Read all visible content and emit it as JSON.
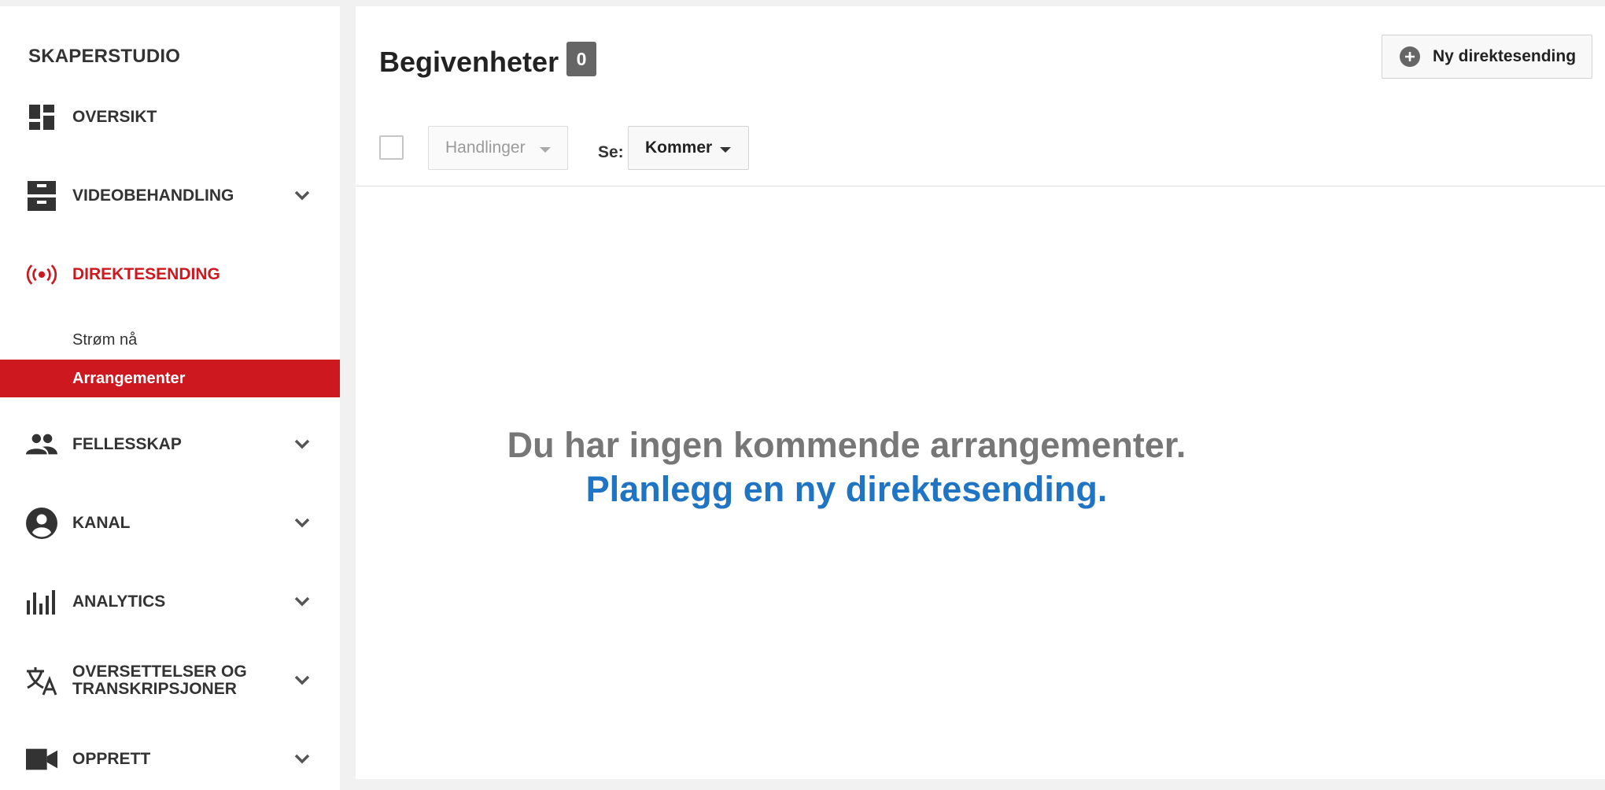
{
  "sidebar": {
    "brand": "SKAPERSTUDIO",
    "items": [
      {
        "label": "OVERSIKT",
        "icon": "dashboard-icon"
      },
      {
        "label": "VIDEOBEHANDLING",
        "icon": "video-manager-icon"
      },
      {
        "label": "DIREKTESENDING",
        "icon": "live-broadcast-icon",
        "active": true
      },
      {
        "label": "FELLESSKAP",
        "icon": "community-icon"
      },
      {
        "label": "KANAL",
        "icon": "account-circle-icon"
      },
      {
        "label": "ANALYTICS",
        "icon": "analytics-icon"
      },
      {
        "label": "OVERSETTELSER OG TRANSKRIPSJONER",
        "icon": "translate-icon"
      },
      {
        "label": "OPPRETT",
        "icon": "video-camera-icon"
      }
    ],
    "live_subitems": [
      {
        "label": "Strøm nå"
      },
      {
        "label": "Arrangementer",
        "selected": true
      }
    ]
  },
  "main": {
    "title": "Begivenheter",
    "count": "0",
    "new_live_button": "Ny direktesending",
    "toolbar": {
      "actions_label": "Handlinger",
      "see_label": "Se:",
      "filter_value": "Kommer"
    },
    "empty_state": {
      "message": "Du har ingen kommende arrangementer.",
      "link": "Planlegg en ny direktesending."
    }
  },
  "colors": {
    "accent_red": "#cc181e",
    "link_blue": "#1f74c4",
    "sidebar_bg": "#ffffff",
    "page_bg": "#f1f1f1"
  }
}
